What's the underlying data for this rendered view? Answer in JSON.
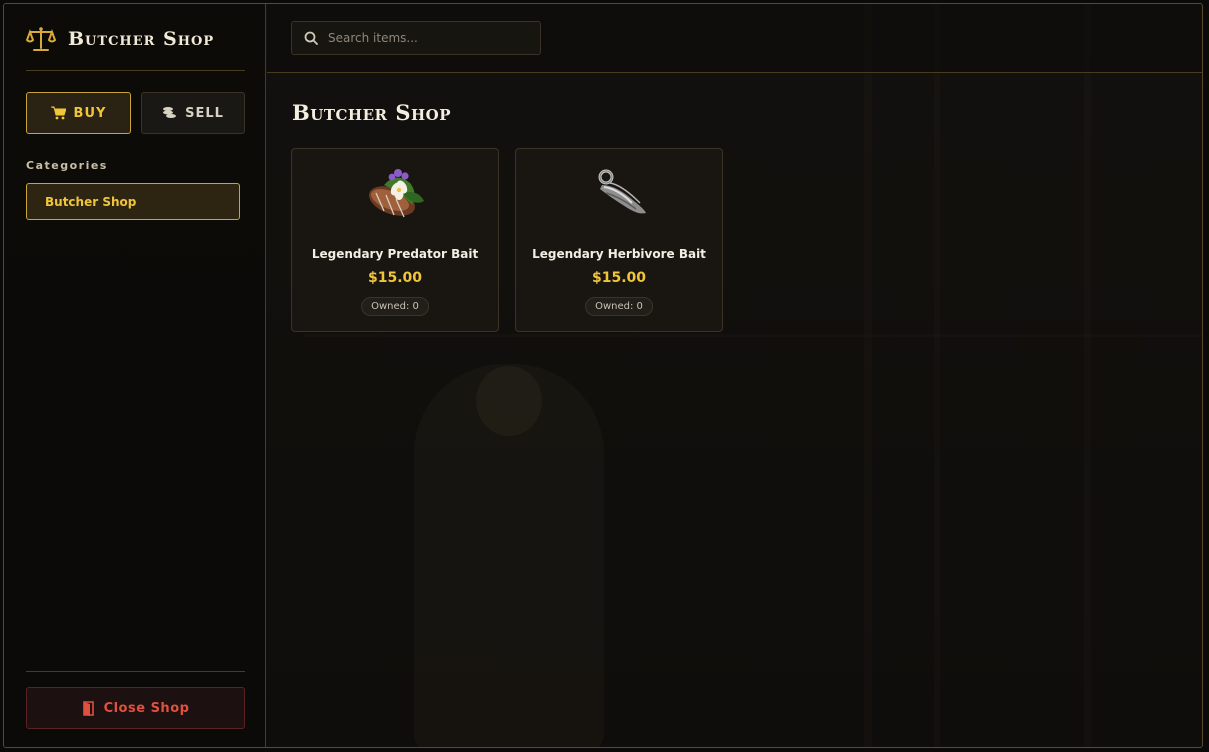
{
  "app": {
    "title": "Butcher Shop"
  },
  "modes": {
    "buy_label": "BUY",
    "sell_label": "SELL",
    "active": "buy"
  },
  "categories": {
    "heading": "Categories",
    "items": [
      {
        "label": "Butcher Shop",
        "selected": true
      }
    ]
  },
  "search": {
    "placeholder": "Search items...",
    "value": ""
  },
  "main": {
    "title": "Butcher Shop"
  },
  "products": [
    {
      "name": "Legendary Predator Bait",
      "price": "$15.00",
      "owned": "Owned: 0",
      "icon": "predator-bait-icon"
    },
    {
      "name": "Legendary Herbivore Bait",
      "price": "$15.00",
      "owned": "Owned: 0",
      "icon": "herbivore-bait-icon"
    }
  ],
  "footer": {
    "close_label": "Close Shop"
  },
  "colors": {
    "accent": "#f0c53a",
    "border": "#4a3c22",
    "danger": "#e0503e",
    "background": "#0f0d0b"
  }
}
